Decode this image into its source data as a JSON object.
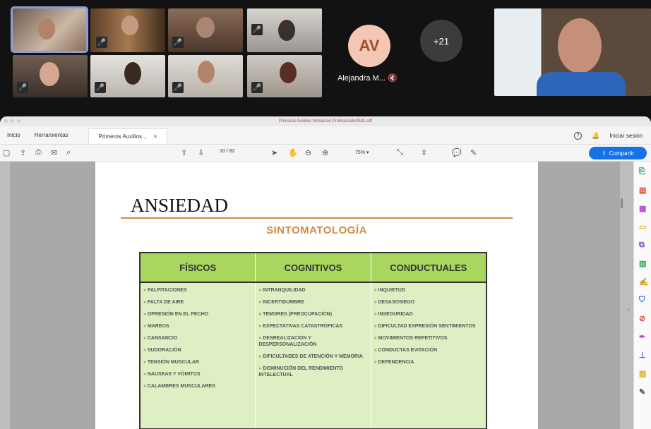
{
  "call": {
    "participant_initials": "AV",
    "participant_name": "Alejandra M...",
    "more_count": "+21",
    "colors": {
      "avatar_bg": "#f3c7b3",
      "avatar_text": "#a34b2c",
      "bubble_bg": "#3c3c3c"
    }
  },
  "acrobat": {
    "window_title": "Primeros Auxilios formación Profesorado8Sd1.sdf",
    "menu": {
      "home": "Inicio",
      "tools": "Herramientas",
      "tab": "Primeros Auxilios...",
      "tab_close": "×"
    },
    "signin": "Iniciar sesión",
    "toolbar": {
      "page_current": "10",
      "page_total": "/ 82",
      "zoom": "75%",
      "share": "Compartir"
    },
    "accent": "#1473e6"
  },
  "document": {
    "title": "ANSIEDAD",
    "subtitle": "SINTOMATOLOGÍA",
    "columns": [
      {
        "header": "FÍSICOS",
        "items": [
          "PALPITACIONES",
          "FALTA DE AIRE",
          "OPRESIÓN EN EL PECHO",
          "MAREOS",
          "CANSANCIO",
          "SUDORACIÓN",
          "TENSIÓN MUSCULAR",
          "NAUSEAS Y VÓMITOS",
          "CALAMBRES MUSCULARES"
        ]
      },
      {
        "header": "COGNITIVOS",
        "items": [
          "INTRANQUILIDAD",
          "INCERTIDUMBRE",
          "TEMORES (PREOCUPACIÓN)",
          "EXPECTATIVAS CATASTRÓFICAS",
          "DESREALIZACIÓN Y DESPERSONALIZACIÓN",
          "DIFICULTADES DE ATENCIÓN Y MEMORIA",
          "DISMINUCIÓN DEL RENDIMIENTO INTELECTUAL"
        ]
      },
      {
        "header": "CONDUCTUALES",
        "items": [
          "INQUIETUD",
          "DESASOSIEGO",
          "INSEGURIDAD",
          "DIFICULTAD EXPRESIÓN SENTIMIENTOS",
          "MOVIMIENTOS REPETITIVOS",
          "CONDUCTAS EVITACIÓN",
          "DEPENDENCIA"
        ]
      }
    ],
    "colors": {
      "rule": "#d58a3f",
      "header_bg": "#a9d65f",
      "body_bg": "#dfefc4"
    }
  }
}
